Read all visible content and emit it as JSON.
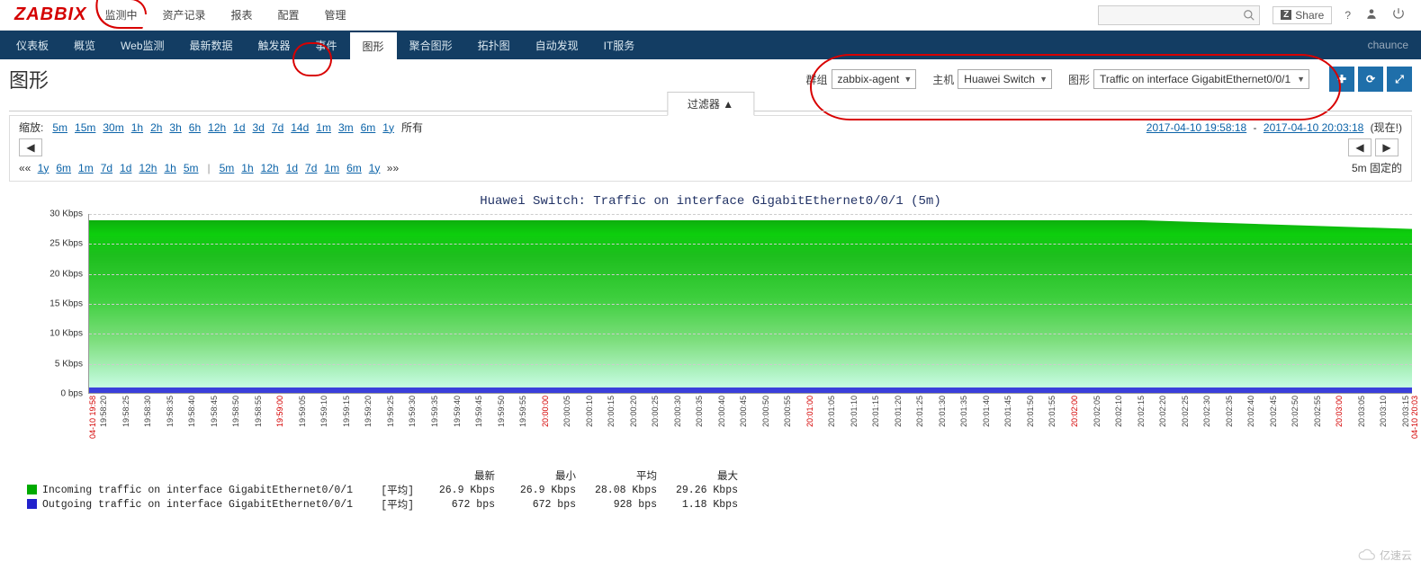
{
  "logo": "ZABBIX",
  "top_nav": {
    "items": [
      "监测中",
      "资产记录",
      "报表",
      "配置",
      "管理"
    ],
    "share": "Share",
    "user": "chaunce"
  },
  "sub_nav": {
    "items": [
      "仪表板",
      "概览",
      "Web监测",
      "最新数据",
      "触发器",
      "事件",
      "图形",
      "聚合图形",
      "拓扑图",
      "自动发现",
      "IT服务"
    ],
    "active": 6
  },
  "page": {
    "title": "图形",
    "group_label": "群组",
    "group_value": "zabbix-agent",
    "host_label": "主机",
    "host_value": "Huawei Switch",
    "graph_label": "图形",
    "graph_value": "Traffic on interface GigabitEthernet0/0/1"
  },
  "filter_tab": "过滤器 ▲",
  "zoom": {
    "label": "缩放:",
    "options": [
      "5m",
      "15m",
      "30m",
      "1h",
      "2h",
      "3h",
      "6h",
      "12h",
      "1d",
      "3d",
      "7d",
      "14d",
      "1m",
      "3m",
      "6m",
      "1y"
    ],
    "all": "所有",
    "time_from": "2017-04-10 19:58:18",
    "time_to": "2017-04-10 20:03:18",
    "now_label": "(现在!)",
    "shift_back": [
      "1y",
      "6m",
      "1m",
      "7d",
      "1d",
      "12h",
      "1h",
      "5m"
    ],
    "shift_fwd": [
      "5m",
      "1h",
      "12h",
      "1d",
      "7d",
      "1m",
      "6m",
      "1y"
    ],
    "fixed_label": "5m  固定的"
  },
  "chart_data": {
    "type": "area",
    "title": "Huawei Switch: Traffic on interface GigabitEthernet0/0/1 (5m)",
    "ylabel": "",
    "yunit": "bps",
    "ylim": [
      0,
      30000
    ],
    "yticks": [
      "0 bps",
      "5 Kbps",
      "10 Kbps",
      "15 Kbps",
      "20 Kbps",
      "25 Kbps",
      "30 Kbps"
    ],
    "x_start": "04-10 19:58",
    "x_end": "04-10 20:03",
    "xticks": [
      "19:58:20",
      "19:58:25",
      "19:58:30",
      "19:58:35",
      "19:58:40",
      "19:58:45",
      "19:58:50",
      "19:58:55",
      "19:59:00",
      "19:59:05",
      "19:59:10",
      "19:59:15",
      "19:59:20",
      "19:59:25",
      "19:59:30",
      "19:59:35",
      "19:59:40",
      "19:59:45",
      "19:59:50",
      "19:59:55",
      "20:00:00",
      "20:00:05",
      "20:00:10",
      "20:00:15",
      "20:00:20",
      "20:00:25",
      "20:00:30",
      "20:00:35",
      "20:00:40",
      "20:00:45",
      "20:00:50",
      "20:00:55",
      "20:01:00",
      "20:01:05",
      "20:01:10",
      "20:01:15",
      "20:01:20",
      "20:01:25",
      "20:01:30",
      "20:01:35",
      "20:01:40",
      "20:01:45",
      "20:01:50",
      "20:01:55",
      "20:02:00",
      "20:02:05",
      "20:02:10",
      "20:02:15",
      "20:02:20",
      "20:02:25",
      "20:02:30",
      "20:02:35",
      "20:02:40",
      "20:02:45",
      "20:02:50",
      "20:02:55",
      "20:03:00",
      "20:03:05",
      "20:03:10",
      "20:03:15"
    ],
    "xticks_red_idx": [
      8,
      20,
      32,
      44,
      56
    ],
    "series": [
      {
        "name": "Incoming traffic on interface GigabitEthernet0/0/1",
        "color": "#00aa00",
        "approx_values_kbps": {
          "start": 29.2,
          "end": 27.5
        }
      },
      {
        "name": "Outgoing traffic on interface GigabitEthernet0/0/1",
        "color": "#2222cc",
        "approx_values_bps": {
          "start": 700,
          "end": 700
        }
      }
    ]
  },
  "legend": {
    "headers": [
      "最新",
      "最小",
      "平均",
      "最大"
    ],
    "agg": "[平均]",
    "rows": [
      {
        "swatch": "#00aa00",
        "name": "Incoming traffic on interface GigabitEthernet0/0/1",
        "last": "26.9 Kbps",
        "min": "26.9 Kbps",
        "avg": "28.08 Kbps",
        "max": "29.26 Kbps"
      },
      {
        "swatch": "#2222cc",
        "name": "Outgoing traffic on interface GigabitEthernet0/0/1",
        "last": "672 bps",
        "min": "672 bps",
        "avg": "928 bps",
        "max": "1.18 Kbps"
      }
    ]
  },
  "footer": "亿速云"
}
